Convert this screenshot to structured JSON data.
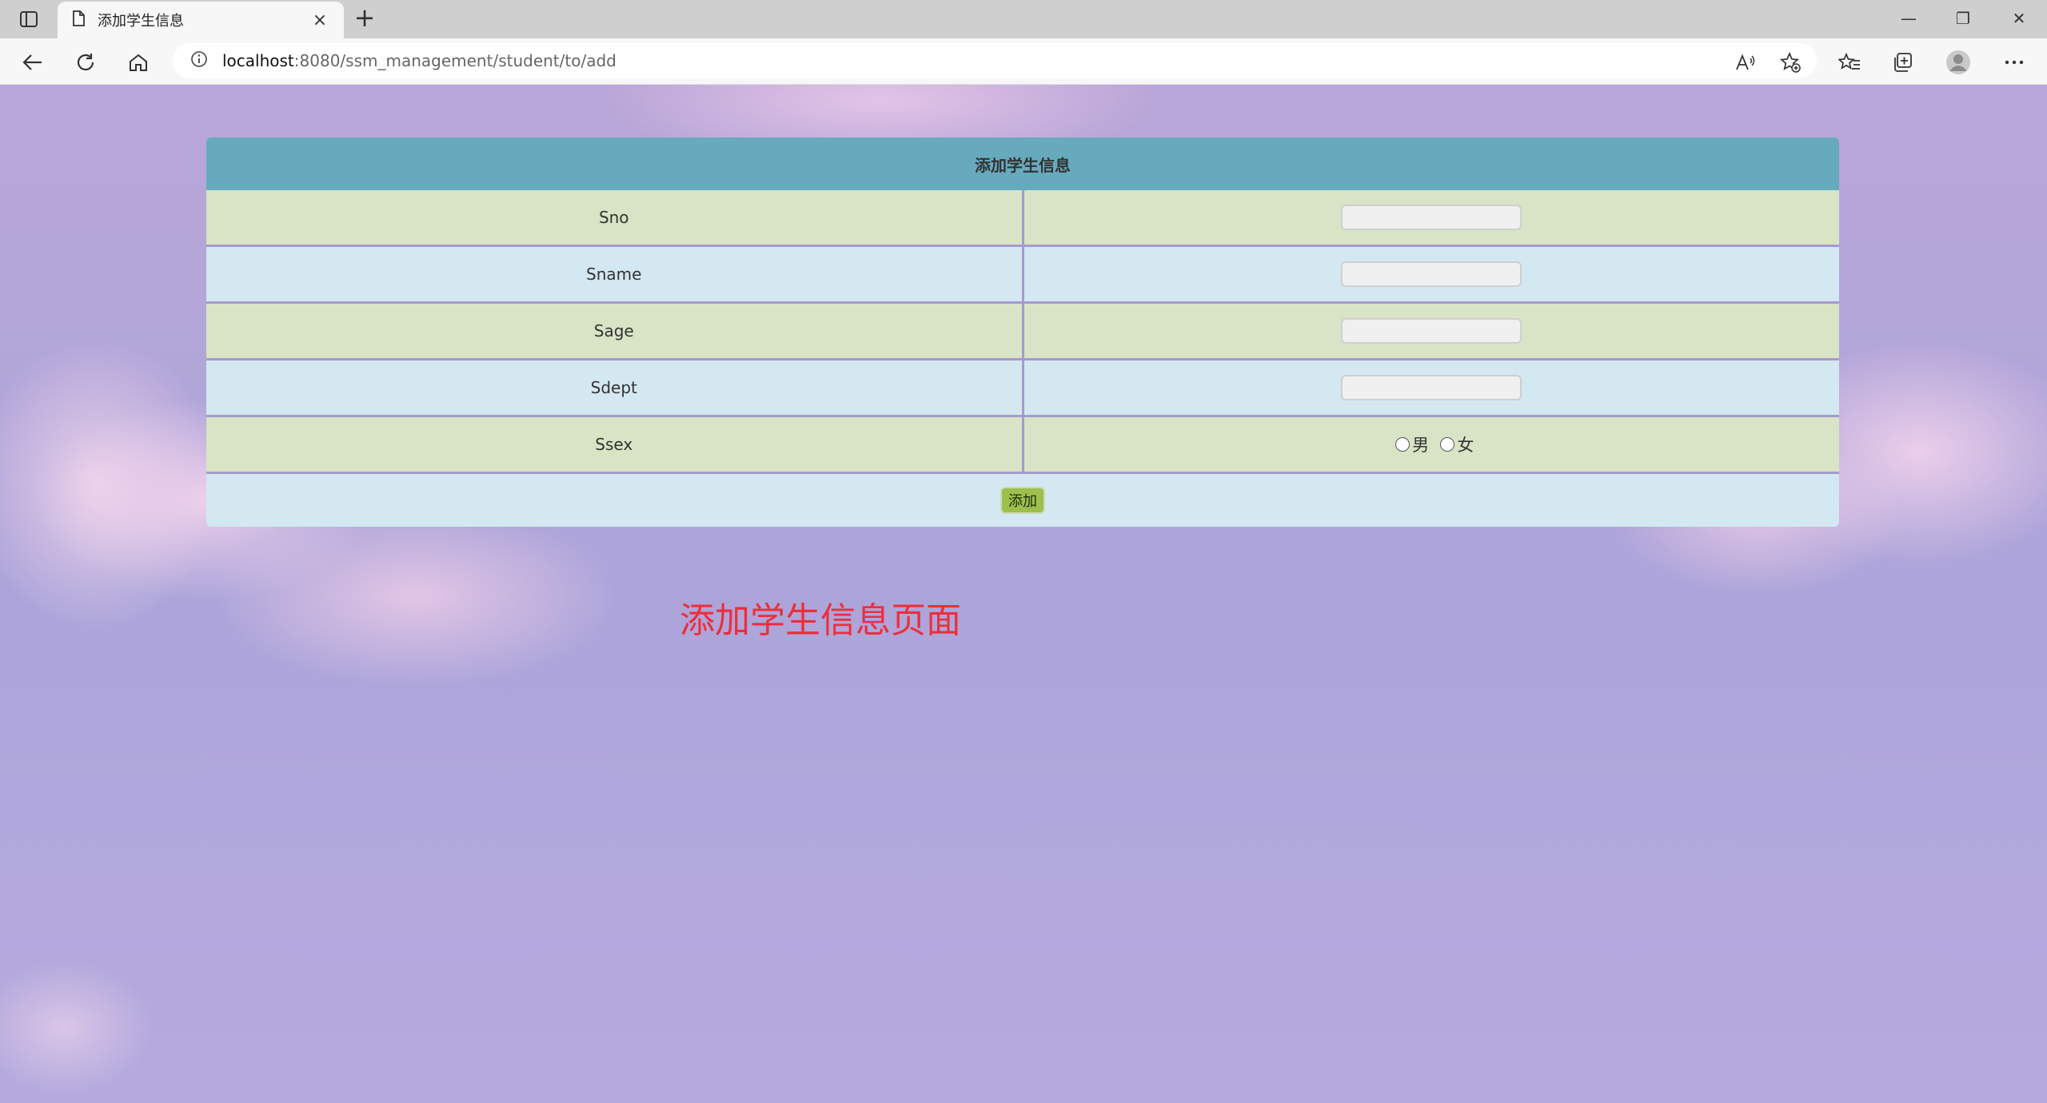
{
  "browser": {
    "tab_title": "添加学生信息",
    "tab_close": "×",
    "new_tab": "+",
    "url_host": "localhost",
    "url_path": ":8080/ssm_management/student/to/add",
    "window_controls": {
      "minimize": "—",
      "restore": "❐",
      "close": "✕"
    }
  },
  "form": {
    "title": "添加学生信息",
    "rows": [
      {
        "label": "Sno"
      },
      {
        "label": "Sname"
      },
      {
        "label": "Sage"
      },
      {
        "label": "Sdept"
      }
    ],
    "sex": {
      "label": "Ssex",
      "options": [
        "男",
        "女"
      ]
    },
    "submit_label": "添加"
  },
  "caption": "添加学生信息页面",
  "colors": {
    "header": "#67aabe",
    "row_green": "#d8e4c5",
    "row_blue": "#d3e8f0",
    "button": "#9dbf4e",
    "caption": "#ee2e3c"
  }
}
